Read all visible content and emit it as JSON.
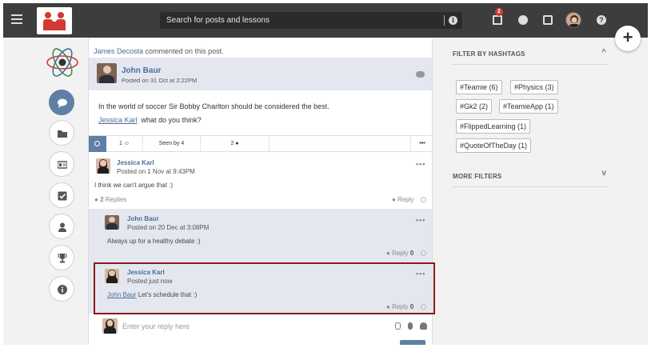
{
  "topbar": {
    "search_placeholder": "Search for posts and lessons",
    "calendar_badge": "2",
    "help_glyph": "?",
    "info_glyph": "i"
  },
  "fab": {
    "label": "+"
  },
  "notification": {
    "actor": "James Decosta",
    "text": " commented on this post."
  },
  "post": {
    "author": "John Baur",
    "posted": "Posted on 31 Oct at 2:22PM",
    "body": "In the world of soccer Sir Bobby Charlton should be considered the best.",
    "mention": "Jessica Karl",
    "mention_text": "what do you think?",
    "stats": {
      "likes": "1",
      "seen": "Seen by 4",
      "comments": "2",
      "more": "•••"
    }
  },
  "comments": [
    {
      "author": "Jessica Karl",
      "posted": "Posted on 1 Nov at 9:43PM",
      "text": "I think we can't argue that :)",
      "replies_count": "2",
      "replies_label": "Replies",
      "reply_label": "Reply",
      "more": "•••"
    }
  ],
  "replies": [
    {
      "author": "John Baur",
      "posted": "Posted on 20 Dec at 3:08PM",
      "text": "Always up for a healthy debate :)",
      "reply_label": "Reply",
      "reply_count": "0",
      "more": "•••"
    },
    {
      "author": "Jessica Karl",
      "posted": "Posted just now",
      "mention": "John Baur",
      "text": " Let's schedule that :)",
      "reply_label": "Reply",
      "reply_count": "0",
      "more": "•••"
    }
  ],
  "reply_input": {
    "placeholder": "Enter your reply here"
  },
  "filters": {
    "hashtags_title": "FILTER BY HASHTAGS",
    "more_title": "MORE FILTERS",
    "chevron_up": "^",
    "chevron_down": "v",
    "tags": [
      "#Teamie (6)",
      "#Physics (3)",
      "#Gk2 (2)",
      "#TeamieApp (1)",
      "#FlippedLearning (1)",
      "#QuoteOfTheDay (1)"
    ]
  },
  "colors": {
    "topbar": "#3d3d3d",
    "accent": "#5f7fa5",
    "link": "#4a6d96",
    "badge": "#d23a33",
    "highlight": "#8b1a1a"
  }
}
